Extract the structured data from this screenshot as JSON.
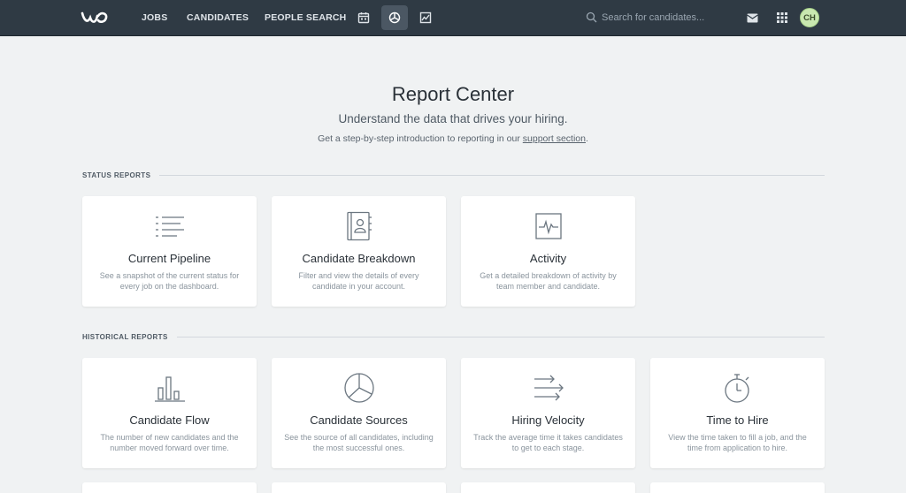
{
  "topbar": {
    "nav": [
      "JOBS",
      "CANDIDATES",
      "PEOPLE SEARCH"
    ],
    "icons": [
      "calendar-icon",
      "reports-icon",
      "analytics-icon"
    ],
    "active_icon": "reports-icon",
    "search_placeholder": "Search for candidates...",
    "avatar_initials": "CH"
  },
  "header": {
    "title": "Report Center",
    "subtitle": "Understand the data that drives your hiring.",
    "intro_text": "Get a step-by-step introduction to reporting in our ",
    "intro_link": "support section",
    "intro_end": "."
  },
  "sections": {
    "status": {
      "label": "STATUS REPORTS",
      "cards": [
        {
          "title": "Current Pipeline",
          "desc": "See a snapshot of the current status for every job on the dashboard.",
          "icon": "pipeline-icon"
        },
        {
          "title": "Candidate Breakdown",
          "desc": "Filter and view the details of every candidate in your account.",
          "icon": "contact-book-icon"
        },
        {
          "title": "Activity",
          "desc": "Get a detailed breakdown of activity by team member and candidate.",
          "icon": "activity-icon"
        }
      ]
    },
    "historical": {
      "label": "HISTORICAL REPORTS",
      "cards": [
        {
          "title": "Candidate Flow",
          "desc": "The number of new candidates and the number moved forward over time.",
          "icon": "bar-chart-icon"
        },
        {
          "title": "Candidate Sources",
          "desc": "See the source of all candidates, including the most successful ones.",
          "icon": "pie-chart-icon"
        },
        {
          "title": "Hiring Velocity",
          "desc": "Track the average time it takes candidates to get to each stage.",
          "icon": "velocity-icon"
        },
        {
          "title": "Time to Hire",
          "desc": "View the time taken to fill a job, and the time from application to hire.",
          "icon": "stopwatch-icon"
        }
      ]
    }
  },
  "colors": {
    "topbar": "#2f3a44",
    "background": "#f0f2f3",
    "card": "#ffffff",
    "avatar": "#c9e8b0"
  }
}
